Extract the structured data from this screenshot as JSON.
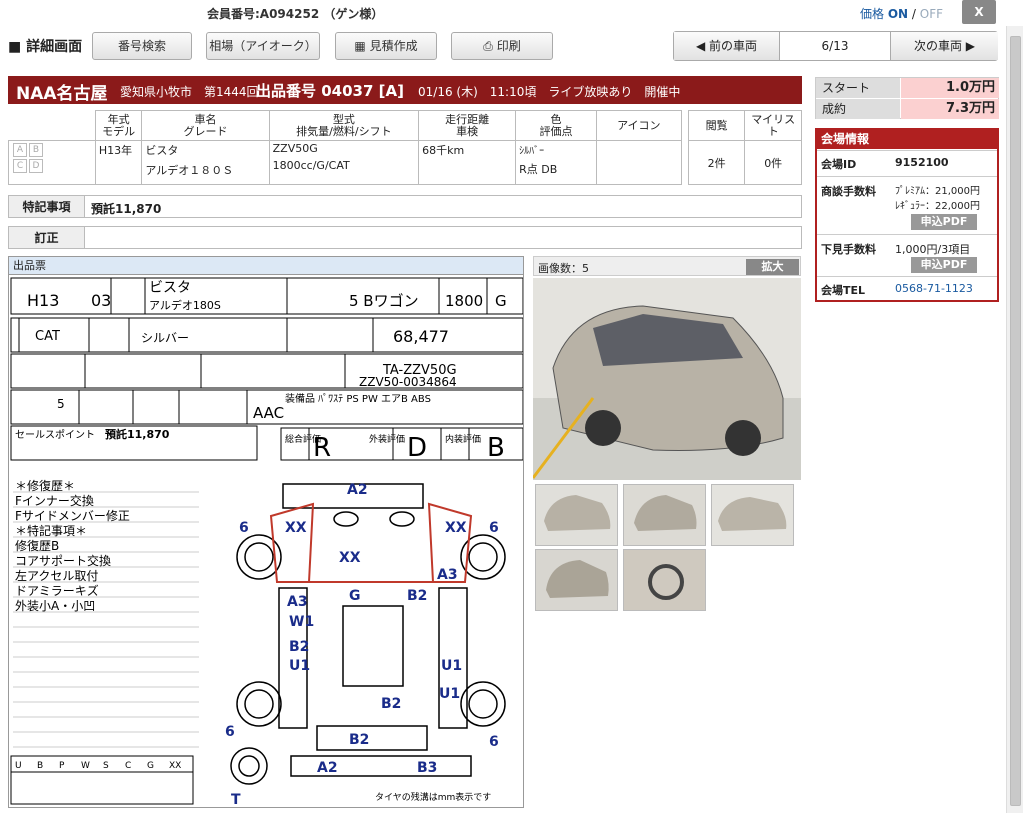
{
  "header": {
    "member": "会員番号:A094252 （ゲン様）",
    "price_label": "価格",
    "price_on": "ON",
    "price_sep": " / ",
    "price_off": "OFF",
    "close_label": "X"
  },
  "toolbar": {
    "title": "■ 詳細画面",
    "btn_search": "番号検索",
    "btn_market": "相場（アイオーク）",
    "btn_estimate": "見積作成",
    "btn_print": "印刷",
    "prev": "◀ 前の車両",
    "counter": "6/13",
    "next": "次の車両 ▶"
  },
  "lot": {
    "auction": "NAA名古屋",
    "location": "愛知県小牧市　第1444回",
    "lot_number": "出品番号 04037 [A]",
    "time": "01/16 (木)　11:10頃　ライブ放映あり　開催中"
  },
  "bids": {
    "start_label": "スタート",
    "start_value": "1.0万円",
    "final_label": "成約",
    "final_value": "7.3万円"
  },
  "venue": {
    "title": "会場情報",
    "id_label": "会場ID",
    "id_value": "9152100",
    "fee_label": "商談手数料",
    "fee_premium": "ﾌﾟﾚﾐｱﾑ：21,000円",
    "fee_regular": "ﾚｷﾞｭﾗｰ：22,000円",
    "apply_pdf": "申込PDF",
    "inspect_label": "下見手数料",
    "inspect_value": "1,000円/3項目",
    "tel_label": "会場TEL",
    "tel_value": "0568-71-1123"
  },
  "table": {
    "h_year": "年式\nモデル",
    "h_name": "車名\nグレード",
    "h_type": "型式\n排気量/燃料/シフト",
    "h_mileage": "走行距離\n車検",
    "h_color": "色\n評価点",
    "h_icon": "アイコン",
    "h_views": "閲覧",
    "h_mylist": "マイリスト",
    "grades": [
      "A",
      "B",
      "C",
      "D"
    ],
    "year": "H13年",
    "name": "ビスタ",
    "grade": "アルデオ１８０Ｓ",
    "type": "ZZV50G",
    "spec": "1800cc/G/CAT",
    "mileage": "68千km",
    "color": "ｼﾙﾊﾞｰ",
    "score": "R点 DB",
    "views": "2件",
    "mylist": "0件"
  },
  "notes": {
    "tokki_label": "特記事項",
    "tokki_value": "預託11,870",
    "teisei_label": "訂正",
    "teisei_value": ""
  },
  "sheet": {
    "title": "出品票",
    "year": "H13",
    "month": "03",
    "car_name": "ビスタ",
    "grade": "アルデオ180S",
    "doors": "5 Bワゴン",
    "cc": "1800",
    "fuel": "G",
    "shift": "CAT",
    "color": "シルバー",
    "mileage": "68,477",
    "model_code": "TA-ZZV50G",
    "chassis": "ZZV50-0034864",
    "seats": "5",
    "ac": "AAC",
    "equip": "装備品 ﾊﾟﾜｽﾃ PS PW エアB ABS",
    "sales_point_label": "セールスポイント",
    "sales_point": "預託11,870",
    "overall_label": "総合評価",
    "overall": "R",
    "ext_label": "外装評価",
    "ext": "D",
    "int_label": "内装評価",
    "int": "B",
    "history": [
      "＊修復歴＊",
      "Fインナー交換",
      "Fサイドメンバー修正",
      "＊特記事項＊",
      "修復歴B",
      "コアサポート交換",
      "左アクセル取付",
      "ドアミラーキズ",
      "外装小A・小凹"
    ],
    "legend": [
      "U",
      "B",
      "P",
      "W",
      "S",
      "C",
      "G",
      "XX"
    ],
    "tire_note": "タイヤの残溝はmm表示です",
    "marks": [
      "A2",
      "XX",
      "XX",
      "6",
      "6",
      "XX",
      "A3",
      "A3",
      "G",
      "B2",
      "W1",
      "B2",
      "U1",
      "U1",
      "U1",
      "B2",
      "B2",
      "6",
      "6",
      "A2",
      "B3",
      "T"
    ]
  },
  "photos": {
    "count": "画像数：5",
    "zoom": "拡大"
  }
}
